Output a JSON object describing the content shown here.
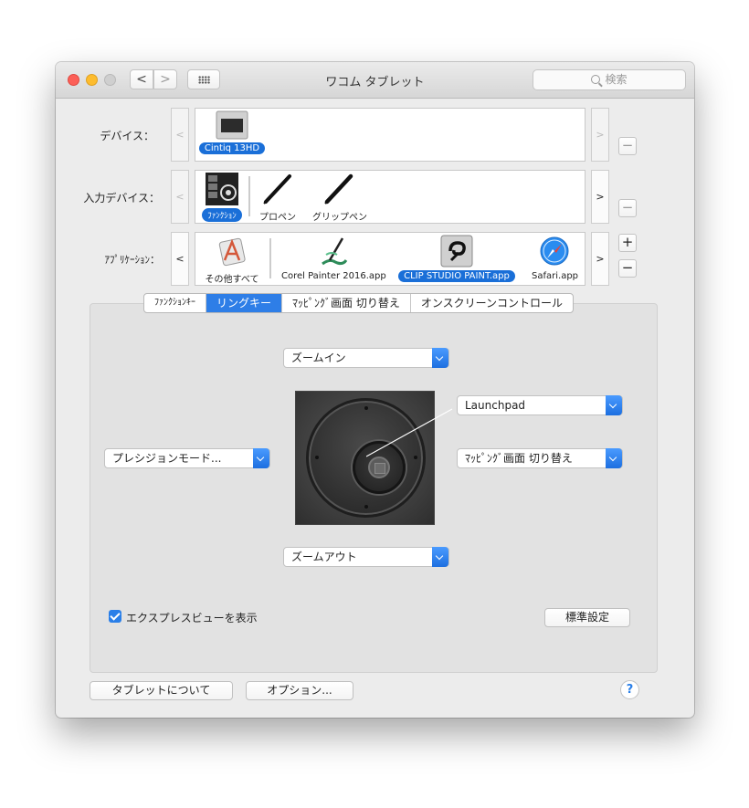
{
  "window": {
    "title": "ワコム タブレット"
  },
  "toolbar": {
    "back": "<",
    "forward": ">",
    "search_placeholder": "検索"
  },
  "device_row": {
    "label": "デバイス：",
    "prev": "<",
    "next": ">",
    "items": [
      {
        "name": "Cintiq 13HD",
        "selected": true
      }
    ],
    "remove": "−"
  },
  "input_row": {
    "label": "入力デバイス：",
    "prev": "<",
    "next": ">",
    "items": [
      {
        "name": "ﾌｧﾝｸｼｮﾝ",
        "selected": true
      },
      {
        "name": "プロペン",
        "selected": false
      },
      {
        "name": "グリップペン",
        "selected": false
      }
    ],
    "remove": "−"
  },
  "app_row": {
    "label": "ｱﾌﾟﾘｹｰｼｮﾝ：",
    "prev": "<",
    "next": ">",
    "items": [
      {
        "name": "その他すべて",
        "selected": false
      },
      {
        "name": "Corel Painter 2016.app",
        "selected": false
      },
      {
        "name": "CLIP STUDIO PAINT.app",
        "selected": true
      },
      {
        "name": "Safari.app",
        "selected": false
      }
    ],
    "add": "+",
    "remove": "−"
  },
  "tabs": [
    {
      "label": "ﾌｧﾝｸｼｮﾝｷｰ",
      "active": false
    },
    {
      "label": "リングキー",
      "active": true
    },
    {
      "label": "ﾏｯﾋﾟﾝｸﾞ画面 切り替え",
      "active": false
    },
    {
      "label": "オンスクリーンコントロール",
      "active": false
    }
  ],
  "ring": {
    "top": "ズームイン",
    "bottom": "ズームアウト",
    "left": "プレシジョンモード...",
    "right_top": "Launchpad",
    "right_middle": "ﾏｯﾋﾟﾝｸﾞ画面 切り替え"
  },
  "express_view": {
    "label": "エクスプレスビューを表示",
    "checked": true
  },
  "buttons": {
    "defaults": "標準設定",
    "about": "タブレットについて",
    "options": "オプション...",
    "help": "?"
  },
  "colors": {
    "accent": "#2e7ee7",
    "selection": "#1a6fd8",
    "panel": "#e2e2e2"
  }
}
